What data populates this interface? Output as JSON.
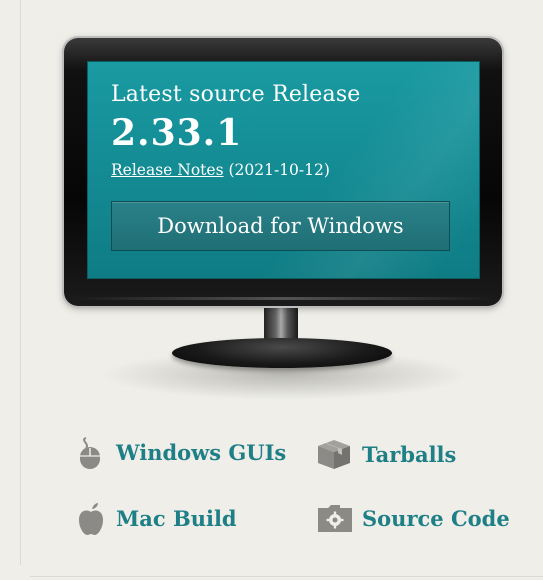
{
  "hero": {
    "heading": "Latest source Release",
    "version": "2.33.1",
    "release_notes_label": "Release Notes",
    "release_date": "(2021-10-12)",
    "download_label": "Download for Windows"
  },
  "links": [
    {
      "label": "Windows GUIs",
      "icon": "mouse-icon"
    },
    {
      "label": "Tarballs",
      "icon": "box-icon"
    },
    {
      "label": "Mac Build",
      "icon": "apple-icon"
    },
    {
      "label": "Source Code",
      "icon": "folder-gear-icon"
    }
  ],
  "colors": {
    "background": "#efeee8",
    "screen": "#138a92",
    "link": "#1e7f87",
    "icon": "#8c8a86"
  }
}
